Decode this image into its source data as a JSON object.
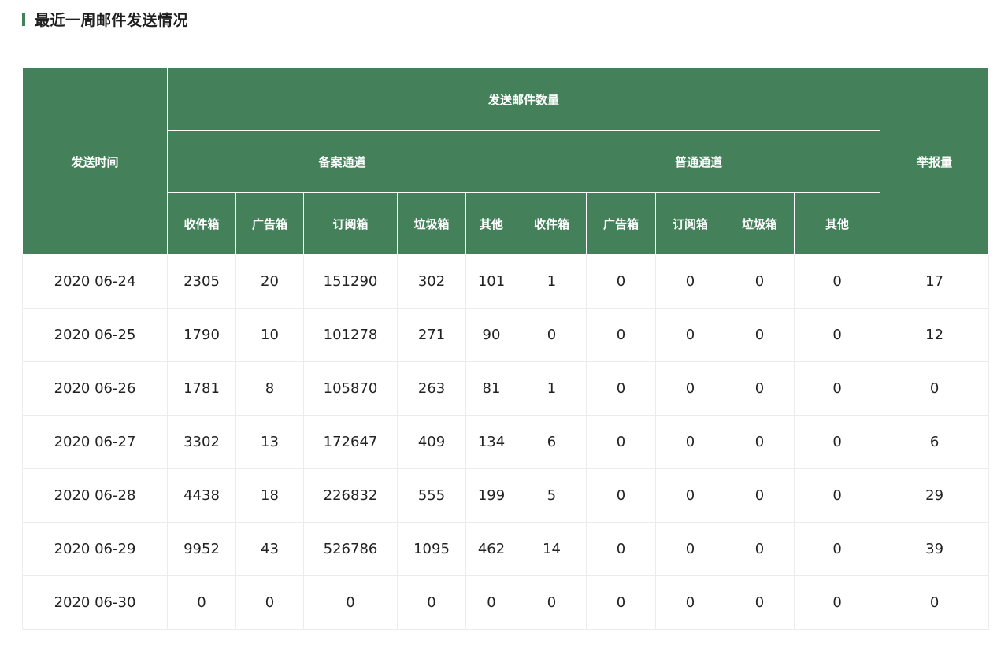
{
  "section": {
    "title": "最近一周邮件发送情况"
  },
  "colors": {
    "header_bg": "#44805a",
    "accent": "#44805a",
    "border": "#ececec"
  },
  "table": {
    "headers": {
      "send_time": "发送时间",
      "send_count": "发送邮件数量",
      "filed_channel": "备案通道",
      "normal_channel": "普通通道",
      "report_count": "举报量",
      "sub_columns": [
        "收件箱",
        "广告箱",
        "订阅箱",
        "垃圾箱",
        "其他",
        "收件箱",
        "广告箱",
        "订阅箱",
        "垃圾箱",
        "其他"
      ]
    },
    "rows": [
      [
        "2020 06-24",
        "2305",
        "20",
        "151290",
        "302",
        "101",
        "1",
        "0",
        "0",
        "0",
        "0",
        "17"
      ],
      [
        "2020 06-25",
        "1790",
        "10",
        "101278",
        "271",
        "90",
        "0",
        "0",
        "0",
        "0",
        "0",
        "12"
      ],
      [
        "2020 06-26",
        "1781",
        "8",
        "105870",
        "263",
        "81",
        "1",
        "0",
        "0",
        "0",
        "0",
        "0"
      ],
      [
        "2020 06-27",
        "3302",
        "13",
        "172647",
        "409",
        "134",
        "6",
        "0",
        "0",
        "0",
        "0",
        "6"
      ],
      [
        "2020 06-28",
        "4438",
        "18",
        "226832",
        "555",
        "199",
        "5",
        "0",
        "0",
        "0",
        "0",
        "29"
      ],
      [
        "2020 06-29",
        "9952",
        "43",
        "526786",
        "1095",
        "462",
        "14",
        "0",
        "0",
        "0",
        "0",
        "39"
      ],
      [
        "2020 06-30",
        "0",
        "0",
        "0",
        "0",
        "0",
        "0",
        "0",
        "0",
        "0",
        "0",
        "0"
      ]
    ]
  }
}
